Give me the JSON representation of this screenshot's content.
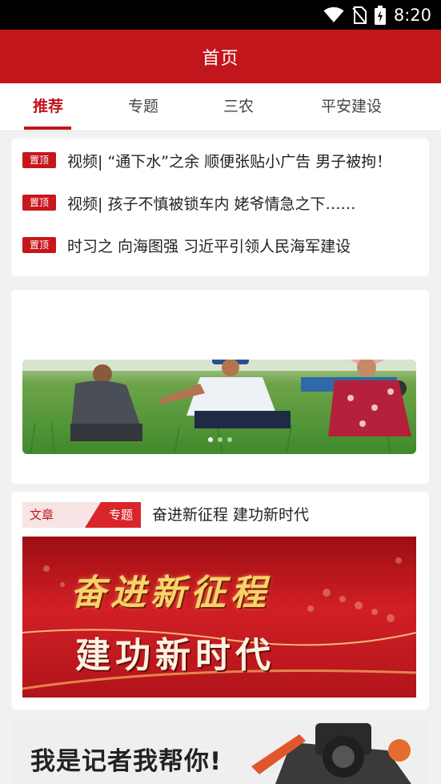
{
  "status_bar": {
    "time": "8:20",
    "icons": [
      "wifi-icon",
      "no-sim-icon",
      "battery-charging-icon"
    ]
  },
  "header": {
    "title": "首页"
  },
  "tabs": [
    {
      "label": "推荐",
      "active": true
    },
    {
      "label": "专题",
      "active": false
    },
    {
      "label": "三农",
      "active": false
    },
    {
      "label": "平安建设",
      "active": false
    }
  ],
  "pinned": [
    {
      "badge": "置顶",
      "text": "视频| “通下水”之余 顺便张贴小广告 男子被拘！"
    },
    {
      "badge": "置顶",
      "text": "视频| 孩子不慎被锁车内 姥爷情急之下……"
    },
    {
      "badge": "置顶",
      "text": "时习之 向海图强 习近平引领人民海军建设"
    }
  ],
  "banner": {
    "slide_count": 3,
    "active_index": 0
  },
  "topic": {
    "tag_left": "文章",
    "tag_right": "专题",
    "title": "奋进新征程 建功新时代",
    "banner_line1": "奋进新征程",
    "banner_line2": "建功新时代"
  },
  "promo": {
    "text": "我是记者我帮你!"
  },
  "colors": {
    "brand_red": "#c1161b",
    "badge_red": "#c8161d",
    "background": "#f1f1f1"
  }
}
